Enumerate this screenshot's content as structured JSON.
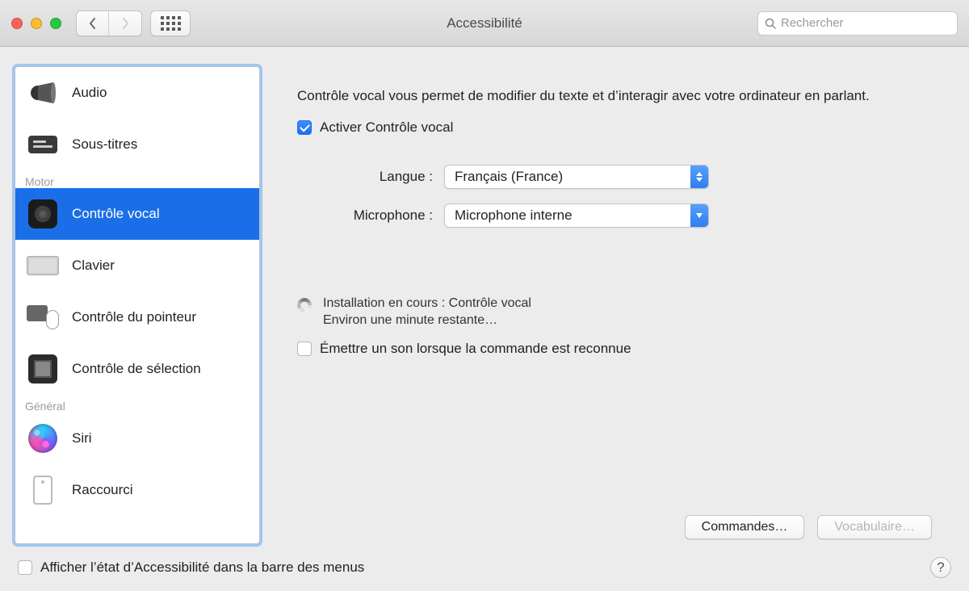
{
  "window_title": "Accessibilité",
  "search_placeholder": "Rechercher",
  "sidebar": {
    "group_motor": "Motor",
    "group_general": "Général",
    "items": {
      "audio": "Audio",
      "subtitles": "Sous-titres",
      "voice_control": "Contrôle vocal",
      "keyboard": "Clavier",
      "pointer_control": "Contrôle du pointeur",
      "switch_control": "Contrôle de sélection",
      "siri": "Siri",
      "shortcut": "Raccourci"
    }
  },
  "main": {
    "description": "Contrôle vocal vous permet de modifier du texte et d’interagir avec votre ordinateur en parlant.",
    "enable_label": "Activer Contrôle vocal",
    "enable_checked": true,
    "language_label": "Langue :",
    "language_value": "Français (France)",
    "microphone_label": "Microphone :",
    "microphone_value": "Microphone interne",
    "status_line1": "Installation en cours : Contrôle vocal",
    "status_line2": "Environ une minute restante…",
    "sound_label": "Émettre un son lorsque la commande est reconnue",
    "sound_checked": false,
    "commands_button": "Commandes…",
    "vocabulary_button": "Vocabulaire…"
  },
  "footer": {
    "show_status_label": "Afficher l’état d’Accessibilité dans la barre des menus",
    "show_status_checked": false
  }
}
